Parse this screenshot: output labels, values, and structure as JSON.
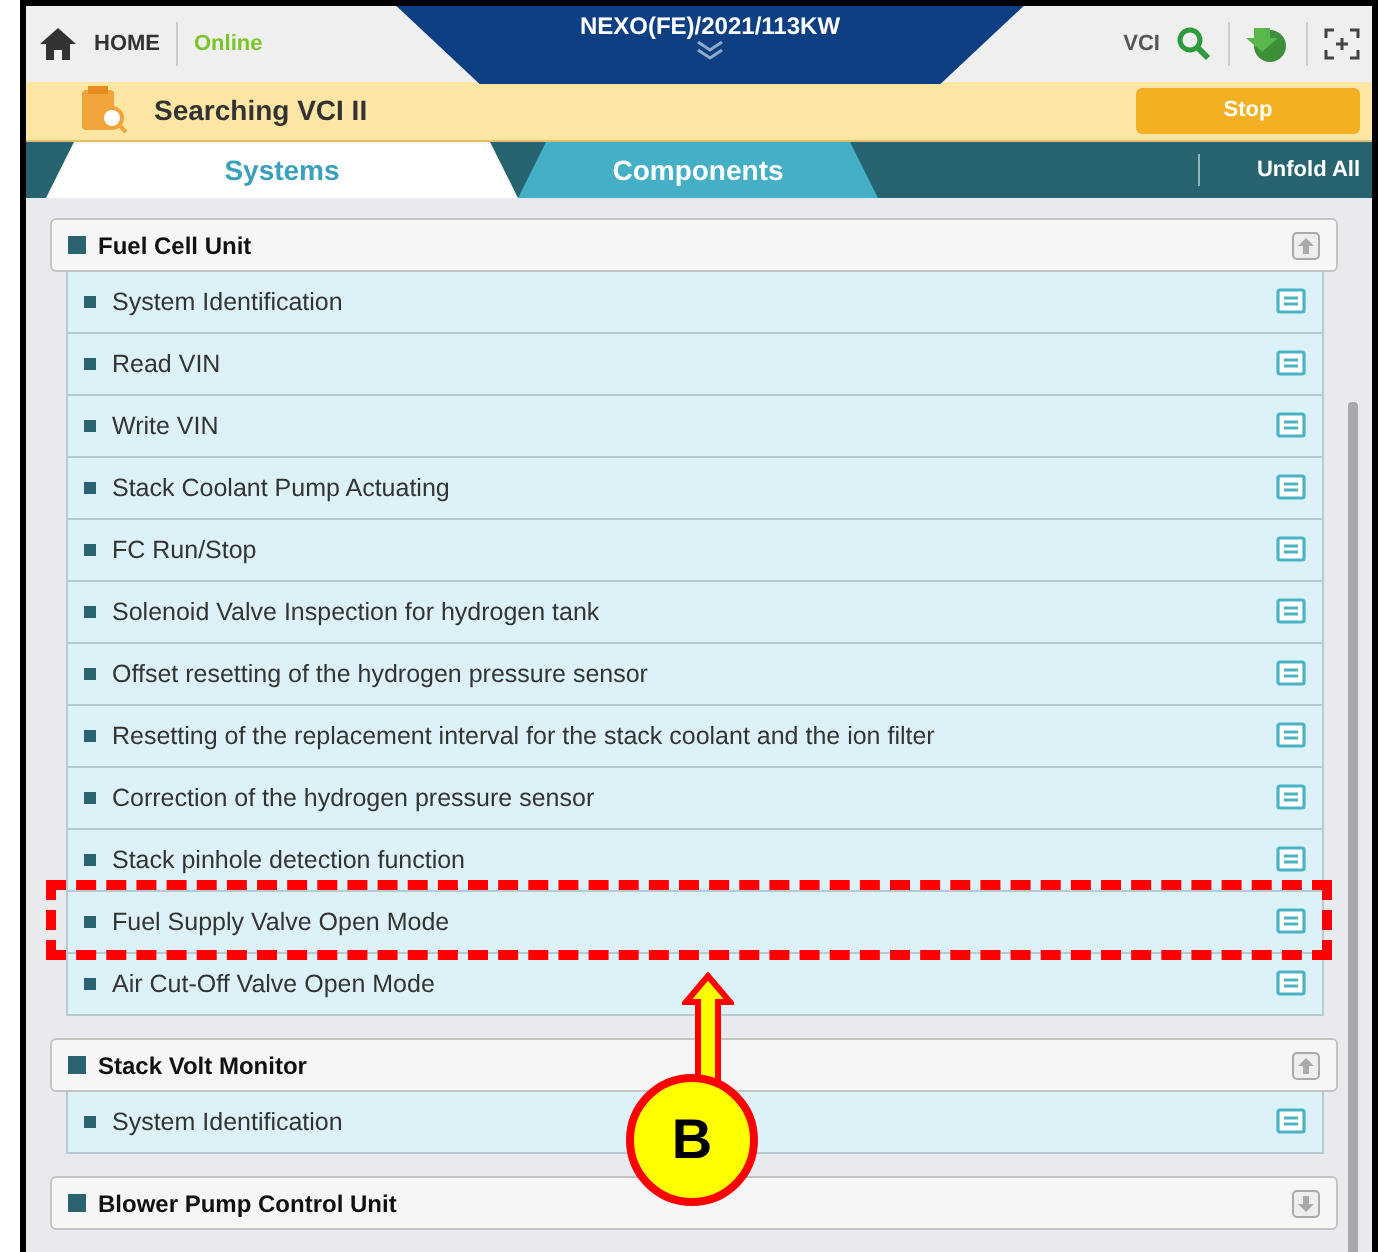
{
  "top_bar": {
    "home_label": "HOME",
    "status": "Online",
    "vehicle": "NEXO(FE)/2021/113KW",
    "vci_label": "VCI"
  },
  "search_bar": {
    "message": "Searching VCI II",
    "stop_button": "Stop"
  },
  "tabs": [
    {
      "label": "Systems",
      "selected": true
    },
    {
      "label": "Components",
      "selected": false
    }
  ],
  "unfold_all": "Unfold All",
  "sections": [
    {
      "title": "Fuel Cell Unit",
      "expanded": true,
      "items": [
        {
          "label": "System Identification",
          "highlighted": false
        },
        {
          "label": "Read VIN",
          "highlighted": false
        },
        {
          "label": "Write VIN",
          "highlighted": false
        },
        {
          "label": "Stack Coolant Pump Actuating",
          "highlighted": false
        },
        {
          "label": "FC Run/Stop",
          "highlighted": false
        },
        {
          "label": "Solenoid Valve Inspection for hydrogen tank",
          "highlighted": false
        },
        {
          "label": "Offset resetting of the hydrogen pressure sensor",
          "highlighted": false
        },
        {
          "label": "Resetting of the replacement interval for the stack coolant and the ion filter",
          "highlighted": false
        },
        {
          "label": "Correction of the hydrogen pressure sensor",
          "highlighted": false
        },
        {
          "label": "Stack pinhole detection function",
          "highlighted": false
        },
        {
          "label": "Fuel Supply Valve Open Mode",
          "highlighted": true
        },
        {
          "label": "Air Cut-Off Valve Open Mode",
          "highlighted": false
        }
      ]
    },
    {
      "title": "Stack Volt Monitor",
      "expanded": true,
      "items": [
        {
          "label": "System Identification",
          "highlighted": false
        }
      ]
    },
    {
      "title": "Blower Pump Control Unit",
      "expanded": false
    }
  ],
  "callout": {
    "label": "B"
  }
}
